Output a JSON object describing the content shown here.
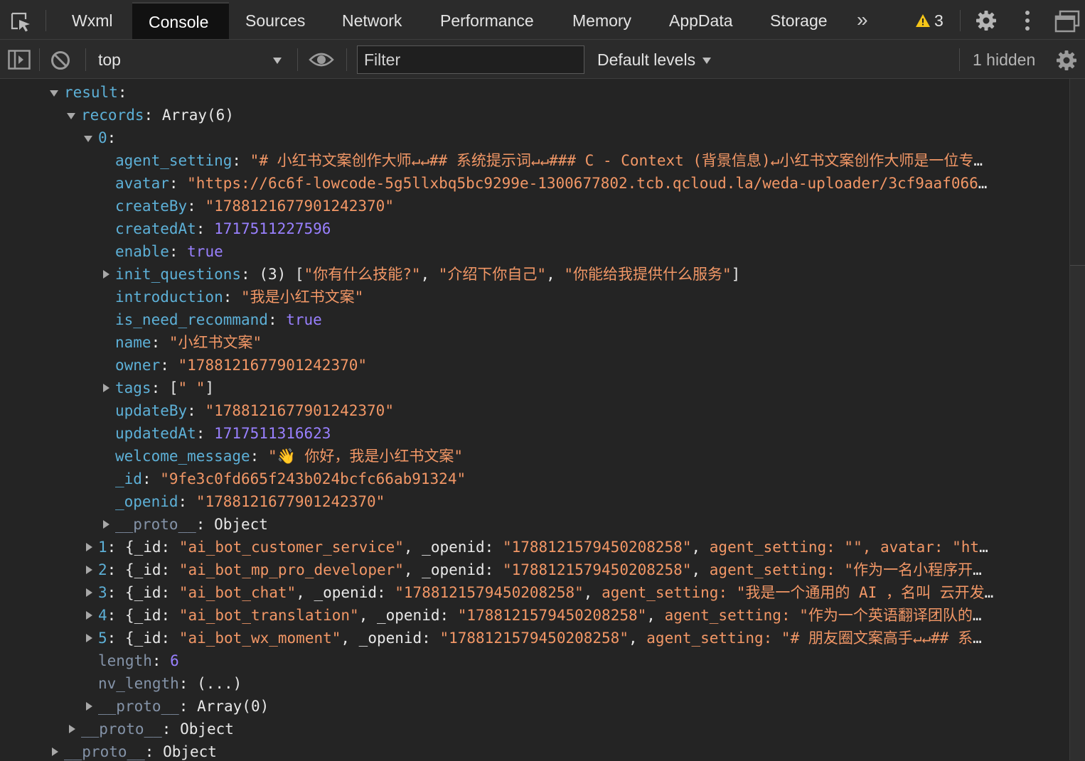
{
  "tabs": [
    "Wxml",
    "Console",
    "Sources",
    "Network",
    "Performance",
    "Memory",
    "AppData",
    "Storage"
  ],
  "active_tab": "Console",
  "more_tabs": "»",
  "warnings_count": "3",
  "toolbar": {
    "context": "top",
    "filter_placeholder": "Filter",
    "levels": "Default levels",
    "hidden": "1 hidden"
  },
  "console": {
    "result_key": "result",
    "records_key": "records",
    "records_summary": "Array(6)",
    "idx0": "0",
    "rec0": {
      "agent_setting_key": "agent_setting",
      "agent_setting_val": "\"# 小红书文案创作大师↵↵## 系统提示词↵↵### C - Context (背景信息)↵小红书文案创作大师是一位专",
      "avatar_key": "avatar",
      "avatar_val": "\"https://6c6f-lowcode-5g5llxbq5bc9299e-1300677802.tcb.qcloud.la/weda-uploader/3cf9aaf066",
      "createBy_key": "createBy",
      "createBy_val": "\"1788121677901242370\"",
      "createdAt_key": "createdAt",
      "createdAt_val": "1717511227596",
      "enable_key": "enable",
      "enable_val": "true",
      "init_questions_key": "init_questions",
      "init_questions_count": "(3)",
      "init_q1": "\"你有什么技能?\"",
      "init_q2": "\"介绍下你自己\"",
      "init_q3": "\"你能给我提供什么服务\"",
      "introduction_key": "introduction",
      "introduction_val": "\"我是小红书文案\"",
      "is_need_recommand_key": "is_need_recommand",
      "is_need_recommand_val": "true",
      "name_key": "name",
      "name_val": "\"小红书文案\"",
      "owner_key": "owner",
      "owner_val": "\"1788121677901242370\"",
      "tags_key": "tags",
      "tags_val": "\" \"",
      "updateBy_key": "updateBy",
      "updateBy_val": "\"1788121677901242370\"",
      "updatedAt_key": "updatedAt",
      "updatedAt_val": "1717511316623",
      "welcome_message_key": "welcome_message",
      "welcome_message_val": "\"👋 你好，我是小红书文案\"",
      "id_key": "_id",
      "id_val": "\"9fe3c0fd665f243b024bcfc66ab91324\"",
      "openid_key": "_openid",
      "openid_val": "\"1788121677901242370\"",
      "proto_key": "__proto__",
      "proto_val": "Object"
    },
    "collapsed": [
      {
        "idx": "1",
        "id": "\"ai_bot_customer_service\"",
        "openid": "\"1788121579450208258\"",
        "tail": "agent_setting: \"\", avatar: \"ht"
      },
      {
        "idx": "2",
        "id": "\"ai_bot_mp_pro_developer\"",
        "openid": "\"1788121579450208258\"",
        "tail": "agent_setting: \"作为一名小程序开"
      },
      {
        "idx": "3",
        "id": "\"ai_bot_chat\"",
        "openid": "\"1788121579450208258\"",
        "tail": "agent_setting: \"我是一个通用的 AI ，名叫 云开发"
      },
      {
        "idx": "4",
        "id": "\"ai_bot_translation\"",
        "openid": "\"1788121579450208258\"",
        "tail": "agent_setting: \"作为一个英语翻译团队的"
      },
      {
        "idx": "5",
        "id": "\"ai_bot_wx_moment\"",
        "openid": "\"1788121579450208258\"",
        "tail": "agent_setting: \"# 朋友圈文案高手↵↵## 系"
      }
    ],
    "length_key": "length",
    "length_val": "6",
    "nv_length_key": "nv_length",
    "nv_length_val": "(...)",
    "records_proto_key": "__proto__",
    "records_proto_val": "Array(0)",
    "result_proto_key": "__proto__",
    "result_proto_val": "Object",
    "outer_proto_key": "__proto__",
    "outer_proto_val": "Object"
  },
  "colors": {
    "background": "#242424",
    "key": "#5db0d7",
    "string": "#f29766",
    "number": "#9980ff",
    "warning": "#f5c518"
  }
}
